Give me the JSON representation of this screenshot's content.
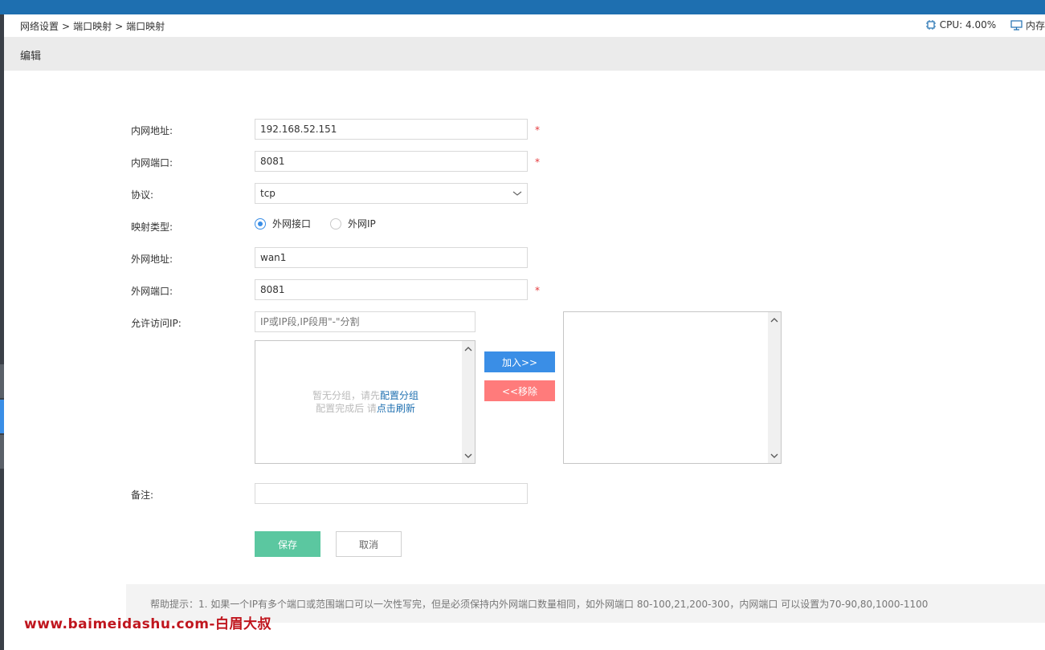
{
  "breadcrumb": [
    "网络设置",
    ">",
    "端口映射",
    ">",
    "端口映射"
  ],
  "sysinfo": {
    "cpu_label": "CPU: 4.00%",
    "mem_label": "内存"
  },
  "header": {
    "title": "编辑"
  },
  "form": {
    "lan_addr": {
      "label": "内网地址:",
      "value": "192.168.52.151",
      "required": "*"
    },
    "lan_port": {
      "label": "内网端口:",
      "value": "8081",
      "required": "*"
    },
    "protocol": {
      "label": "协议:",
      "value": "tcp"
    },
    "map_type": {
      "label": "映射类型:",
      "options": [
        "外网接口",
        "外网IP"
      ],
      "selected": "外网接口"
    },
    "wan_addr": {
      "label": "外网地址:",
      "value": "wan1"
    },
    "wan_port": {
      "label": "外网端口:",
      "value": "8081",
      "required": "*"
    },
    "allow_ip": {
      "label": "允许访问IP:",
      "placeholder": "IP或IP段,IP段用\"-\"分割",
      "empty_line1_prefix": "暂无分组，请先",
      "empty_line1_link": "配置分组",
      "empty_line2_prefix": "配置完成后 请",
      "empty_line2_link": "点击刷新",
      "add_label": "加入>>",
      "remove_label": "<<移除"
    },
    "remark": {
      "label": "备注:",
      "value": ""
    },
    "save_label": "保存",
    "cancel_label": "取消"
  },
  "help": {
    "text": "帮助提示：1. 如果一个IP有多个端口或范围端口可以一次性写完，但是必须保持内外网端口数量相同，如外网端口 80-100,21,200-300，内网端口 可以设置为70-90,80,1000-1100"
  },
  "watermark": "www.baimeidashu.com-白眉大叔",
  "colors": {
    "topbar": "#1e6fb0",
    "primary": "#3a8ee6",
    "danger": "#ff7b7b",
    "success": "#5bc7a0",
    "required": "#e4393c"
  }
}
